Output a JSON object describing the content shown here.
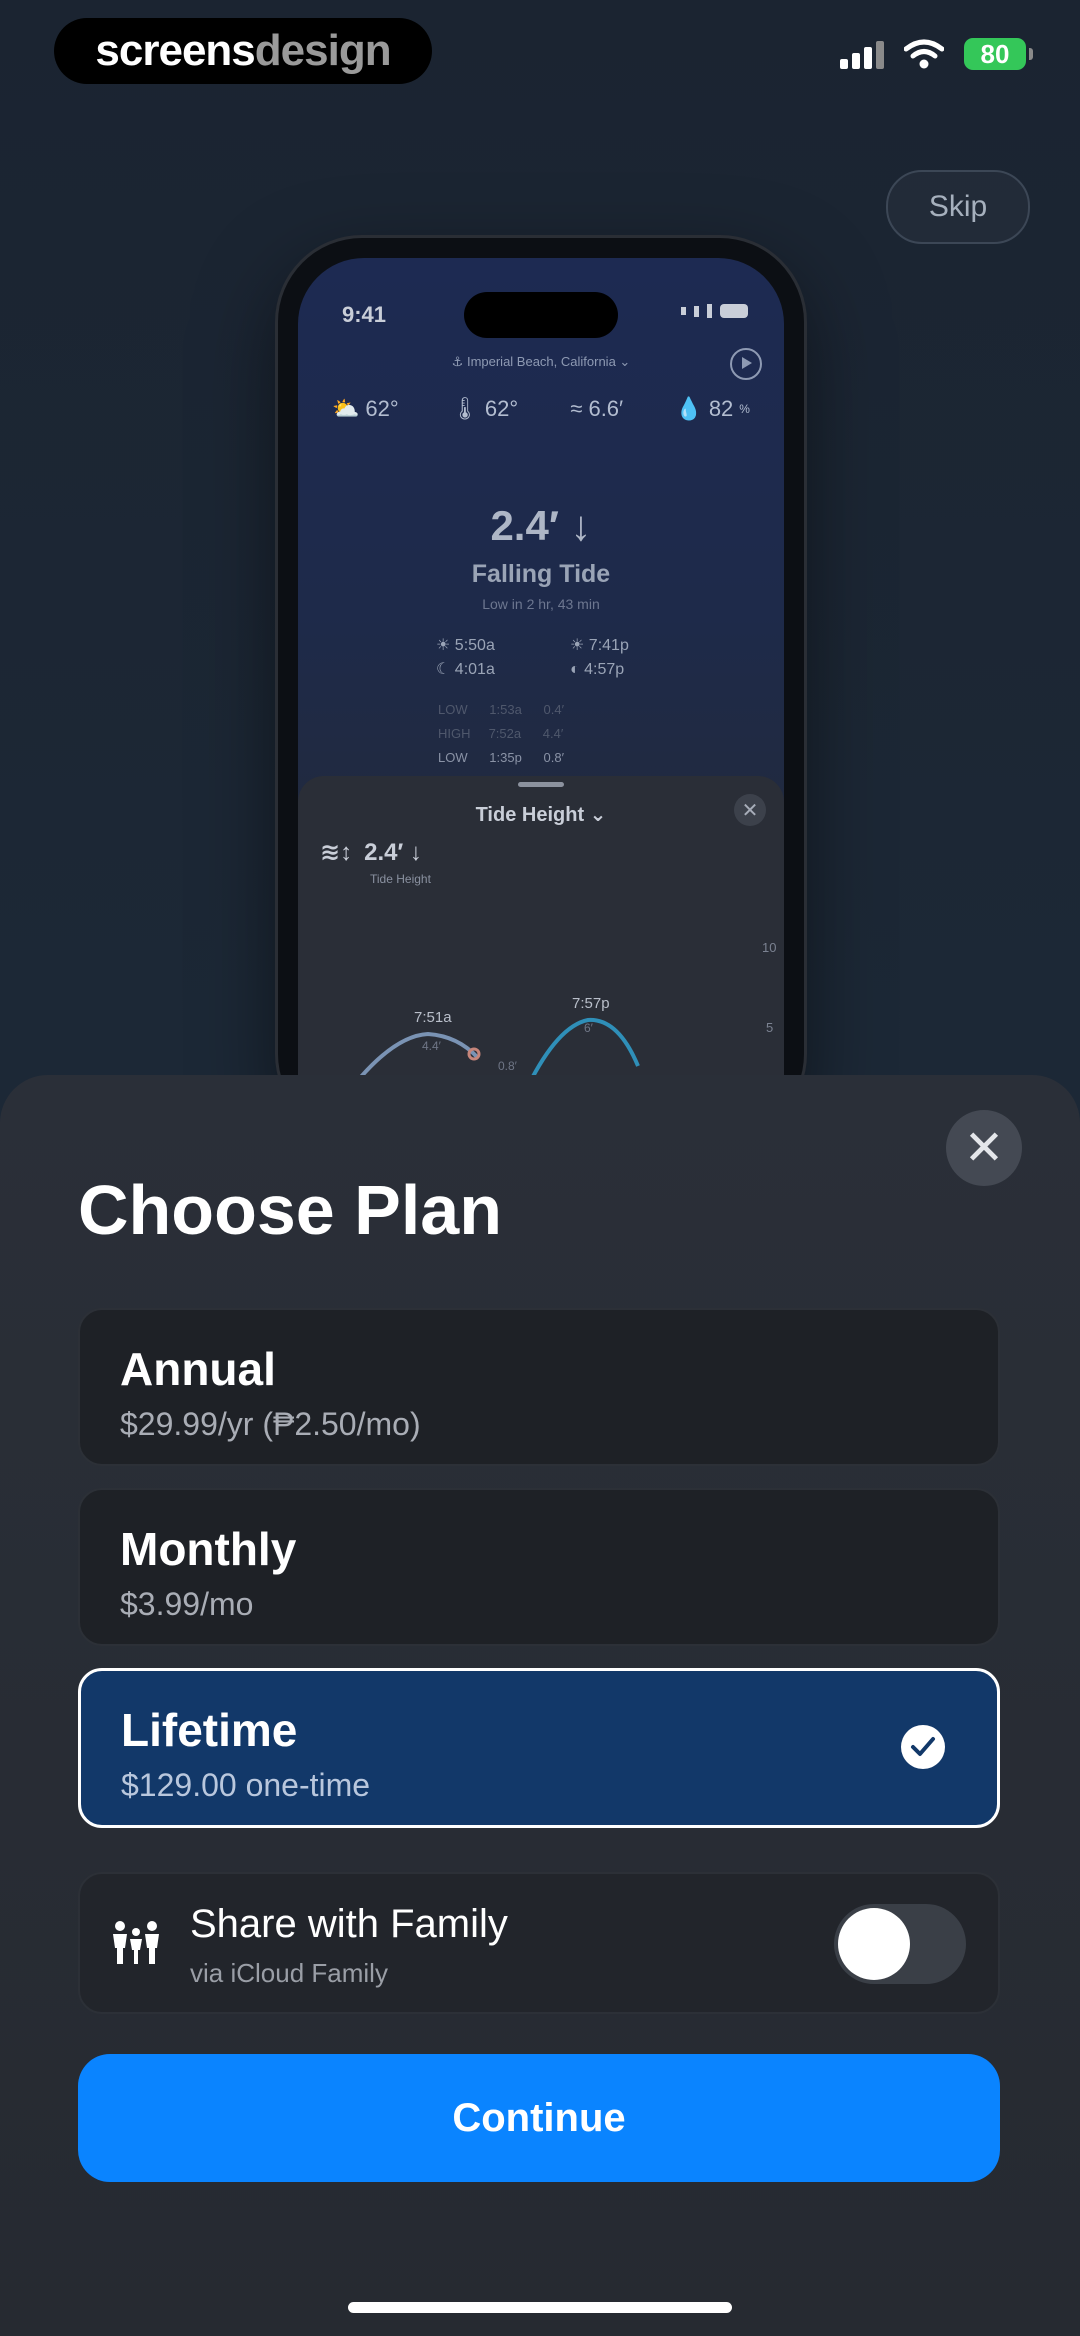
{
  "status_bar": {
    "brand_part1": "screens",
    "brand_part2": "design",
    "battery": "80"
  },
  "skip_label": "Skip",
  "phone_preview": {
    "time": "9:41",
    "location": "Imperial Beach, California",
    "stats": [
      {
        "icon": "partly-cloudy-icon",
        "value": "62°"
      },
      {
        "icon": "thermometer-icon",
        "value": "62°"
      },
      {
        "icon": "wave-icon",
        "value": "6.6′"
      },
      {
        "icon": "humidity-icon",
        "value": "82",
        "unit": "%"
      }
    ],
    "tide_value": "2.4′ ↓",
    "tide_state": "Falling Tide",
    "tide_next": "Low in 2 hr, 43 min",
    "sunrise": "5:50a",
    "sunset": "7:41p",
    "moonrise": "4:01a",
    "moonset": "4:57p",
    "tide_rows": [
      {
        "type": "LOW",
        "time": "1:53a",
        "height": "0.4′"
      },
      {
        "type": "HIGH",
        "time": "7:52a",
        "height": "4.4′"
      },
      {
        "type": "LOW",
        "time": "1:35p",
        "height": "0.8′"
      }
    ],
    "sheet_title": "Tide Height ⌄",
    "sheet_value": "2.4′ ↓",
    "sheet_label": "Tide Height",
    "chart_labels": {
      "y_top": "10",
      "y_mid": "5",
      "peak1_time": "7:51a",
      "peak1_height": "4.4′",
      "peak2_time": "7:57p",
      "peak2_height": "6′",
      "trough": "0.8′"
    }
  },
  "sheet": {
    "title": "Choose Plan",
    "plans": [
      {
        "name": "Annual",
        "price": "$29.99/yr (₱2.50/mo)",
        "selected": false
      },
      {
        "name": "Monthly",
        "price": "$3.99/mo",
        "selected": false
      },
      {
        "name": "Lifetime",
        "price": "$129.00 one-time",
        "selected": true
      }
    ],
    "family": {
      "title": "Share with Family",
      "subtitle": "via iCloud Family",
      "enabled": false
    },
    "continue_label": "Continue"
  },
  "colors": {
    "accent": "#0a84ff",
    "selected_plan": "#123869",
    "battery": "#34c759"
  }
}
